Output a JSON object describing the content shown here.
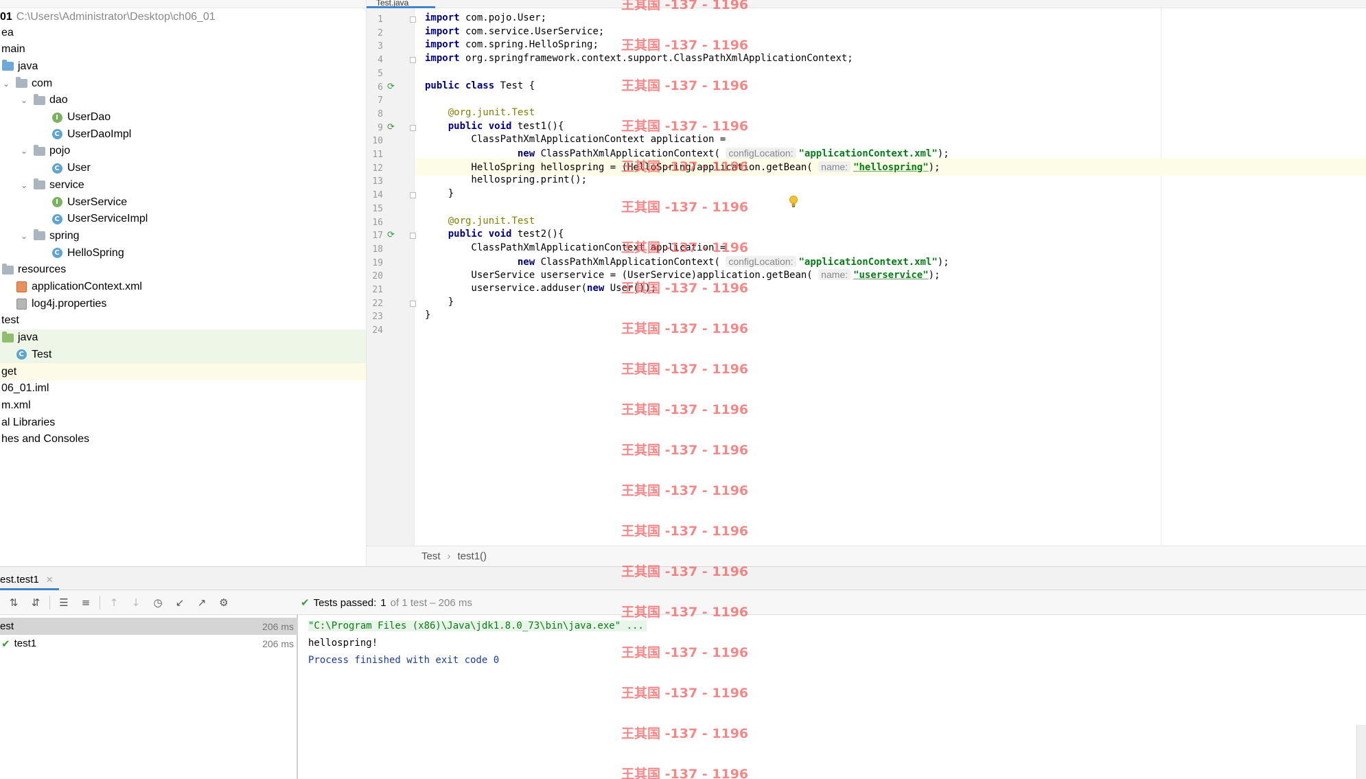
{
  "project": {
    "root_name": "01",
    "root_path": "C:\\Users\\Administrator\\Desktop\\ch06_01",
    "items": [
      {
        "label": "ea",
        "kind": "none",
        "indent": 0
      },
      {
        "label": "main",
        "kind": "none",
        "indent": 0
      },
      {
        "label": "java",
        "kind": "folder-blue",
        "indent": 0
      },
      {
        "label": "com",
        "kind": "folder",
        "indent": 1,
        "expanded": true
      },
      {
        "label": "dao",
        "kind": "folder",
        "indent": 2,
        "expanded": true
      },
      {
        "label": "UserDao",
        "kind": "interface",
        "indent": 3
      },
      {
        "label": "UserDaoImpl",
        "kind": "class",
        "indent": 3
      },
      {
        "label": "pojo",
        "kind": "folder",
        "indent": 2,
        "expanded": true
      },
      {
        "label": "User",
        "kind": "class",
        "indent": 3
      },
      {
        "label": "service",
        "kind": "folder",
        "indent": 2,
        "expanded": true
      },
      {
        "label": "UserService",
        "kind": "interface",
        "indent": 3
      },
      {
        "label": "UserServiceImpl",
        "kind": "class",
        "indent": 3
      },
      {
        "label": "spring",
        "kind": "folder",
        "indent": 2,
        "expanded": true
      },
      {
        "label": "HelloSpring",
        "kind": "class",
        "indent": 3
      },
      {
        "label": "resources",
        "kind": "folder-res",
        "indent": 0
      },
      {
        "label": "applicationContext.xml",
        "kind": "xml",
        "indent": 1
      },
      {
        "label": "log4j.properties",
        "kind": "props",
        "indent": 1
      },
      {
        "label": "test",
        "kind": "none",
        "indent": 0
      },
      {
        "label": "java",
        "kind": "folder-green",
        "indent": 0,
        "highlight": "green"
      },
      {
        "label": "Test",
        "kind": "class",
        "indent": 1,
        "highlight": "green"
      },
      {
        "label": "get",
        "kind": "none",
        "indent": 0,
        "highlight": "yellow"
      },
      {
        "label": "06_01.iml",
        "kind": "none",
        "indent": 0
      },
      {
        "label": "m.xml",
        "kind": "none",
        "indent": 0
      },
      {
        "label": "al Libraries",
        "kind": "none",
        "indent": 0
      },
      {
        "label": "hes and Consoles",
        "kind": "none",
        "indent": 0
      }
    ]
  },
  "editor": {
    "tab_label": "Test.java",
    "current_line": 12,
    "lines": [
      [
        {
          "t": "import",
          "c": "kw"
        },
        {
          "t": " com.pojo.User;"
        }
      ],
      [
        {
          "t": "import",
          "c": "kw"
        },
        {
          "t": " com.service.UserService;"
        }
      ],
      [
        {
          "t": "import",
          "c": "kw"
        },
        {
          "t": " com.spring.HelloSpring;"
        }
      ],
      [
        {
          "t": "import",
          "c": "kw"
        },
        {
          "t": " org.springframework.context.support.ClassPathXmlApplicationContext;"
        }
      ],
      [],
      [
        {
          "t": "public class",
          "c": "kw"
        },
        {
          "t": " Test {"
        }
      ],
      [],
      [
        {
          "t": "    "
        },
        {
          "t": "@org.junit.",
          "c": "ann"
        },
        {
          "t": "Test",
          "c": "ann"
        }
      ],
      [
        {
          "t": "    "
        },
        {
          "t": "public void",
          "c": "kw"
        },
        {
          "t": " test1(){"
        }
      ],
      [
        {
          "t": "        ClassPathXmlApplicationContext application ="
        }
      ],
      [
        {
          "t": "                "
        },
        {
          "t": "new",
          "c": "kw"
        },
        {
          "t": " ClassPathXmlApplicationContext( "
        },
        {
          "t": "configLocation:",
          "c": "hint"
        },
        {
          "t": "\"applicationContext.xml\"",
          "c": "str"
        },
        {
          "t": ");"
        }
      ],
      [
        {
          "t": "        HelloSpring hellospring = (HelloSpring)application.getBean( "
        },
        {
          "t": "name:",
          "c": "hint"
        },
        {
          "t": "\"hellospring\"",
          "c": "str-u"
        },
        {
          "t": ");"
        }
      ],
      [
        {
          "t": "        hellospring.print();"
        }
      ],
      [
        {
          "t": "    }"
        }
      ],
      [],
      [
        {
          "t": "    "
        },
        {
          "t": "@org.junit.",
          "c": "ann"
        },
        {
          "t": "Test",
          "c": "ann"
        }
      ],
      [
        {
          "t": "    "
        },
        {
          "t": "public void",
          "c": "kw"
        },
        {
          "t": " test2(){"
        }
      ],
      [
        {
          "t": "        ClassPathXmlApplicationContext application ="
        }
      ],
      [
        {
          "t": "                "
        },
        {
          "t": "new",
          "c": "kw"
        },
        {
          "t": " ClassPathXmlApplicationContext( "
        },
        {
          "t": "configLocation:",
          "c": "hint"
        },
        {
          "t": "\"applicationContext.xml\"",
          "c": "str"
        },
        {
          "t": ");"
        }
      ],
      [
        {
          "t": "        UserService userservice = (UserService)application.getBean( "
        },
        {
          "t": "name:",
          "c": "hint"
        },
        {
          "t": "\"userservice\"",
          "c": "str-u"
        },
        {
          "t": ");"
        }
      ],
      [
        {
          "t": "        userservice.adduser("
        },
        {
          "t": "new",
          "c": "kw"
        },
        {
          "t": " User());"
        }
      ],
      [
        {
          "t": "    }"
        }
      ],
      [
        {
          "t": "}"
        }
      ],
      []
    ],
    "run_marks": [
      6,
      9,
      17
    ],
    "fold_marks": [
      1,
      4,
      9,
      14,
      17,
      22
    ],
    "breadcrumb": [
      "Test",
      "test1()"
    ]
  },
  "run": {
    "tab_label": "est.test1",
    "status": {
      "passed_label": "Tests passed:",
      "passed_count": "1",
      "summary": "of 1 test – 206 ms"
    },
    "tree": [
      {
        "label": "est",
        "time": "206 ms",
        "selected": true,
        "passed": false
      },
      {
        "label": "test1",
        "time": "206 ms",
        "selected": false,
        "passed": true
      }
    ],
    "console": [
      {
        "text": "\"C:\\Program Files (x86)\\Java\\jdk1.8.0_73\\bin\\java.exe\" ...",
        "kind": "cmd"
      },
      {
        "text": "hellospring!",
        "kind": "out"
      },
      {
        "text": "Process finished with exit code 0",
        "kind": "exit"
      }
    ]
  },
  "watermark": {
    "text": "王其国 -137 - 1196",
    "count": 20
  }
}
